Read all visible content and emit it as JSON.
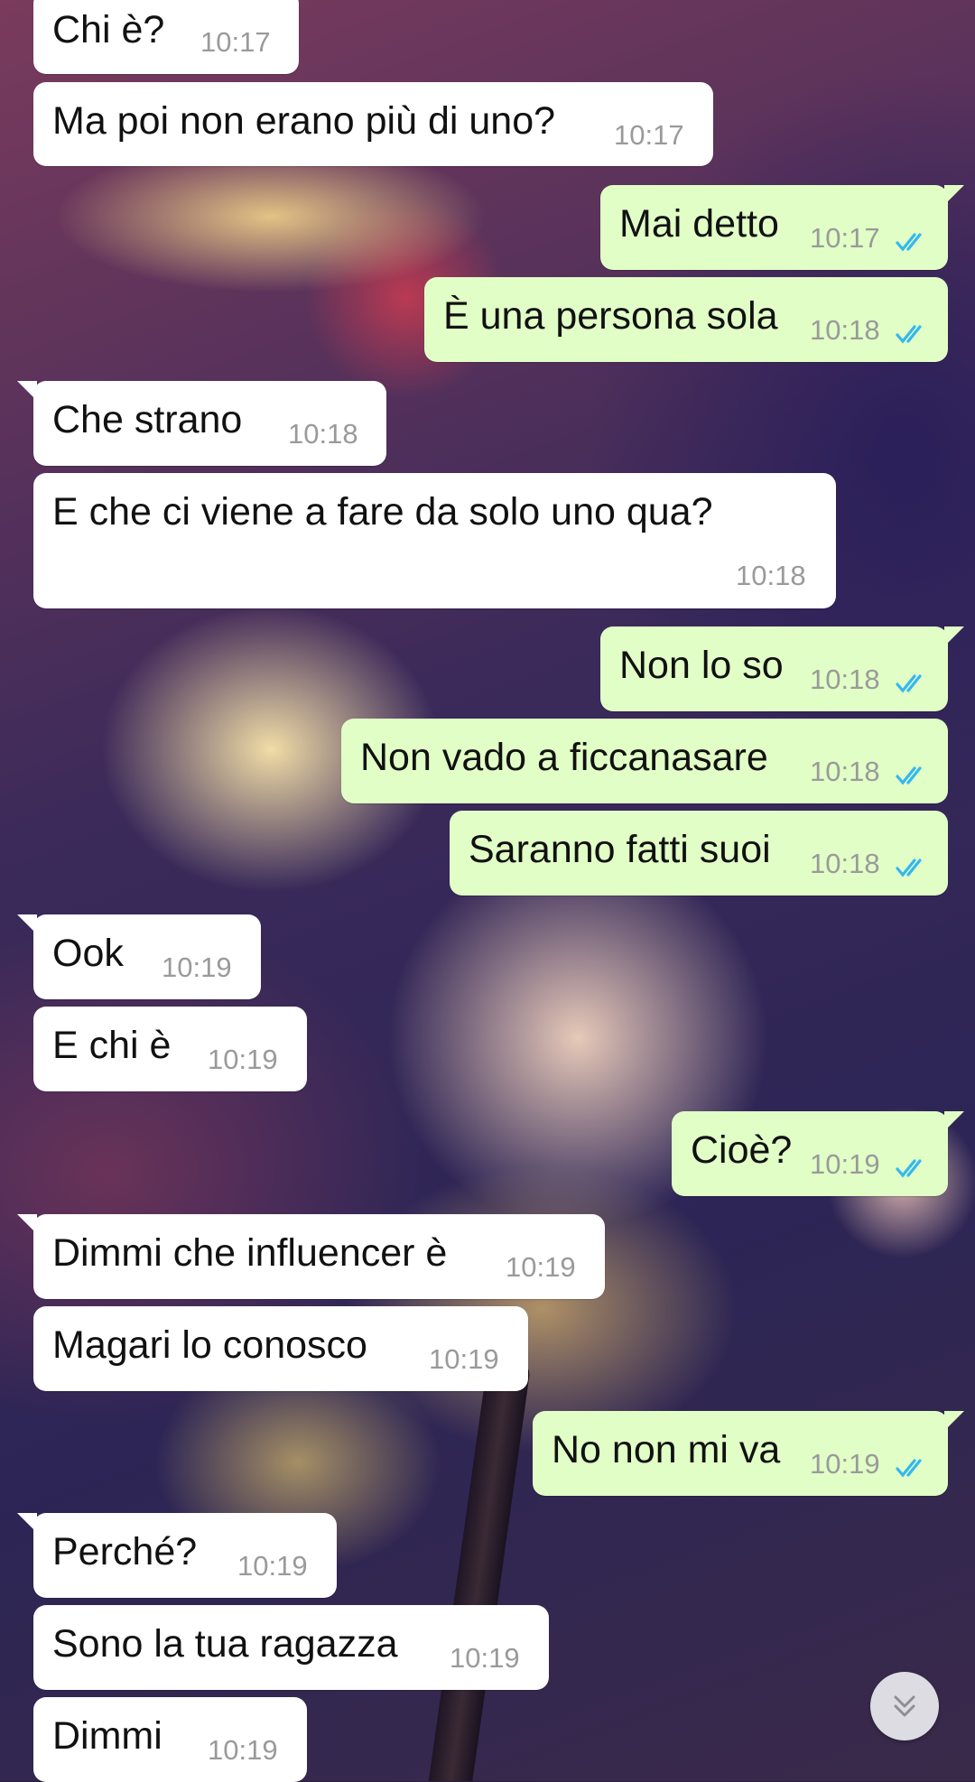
{
  "colors": {
    "incoming": "#ffffff",
    "outgoing": "#e1fec6",
    "time": "#9a9a9a",
    "read_ticks": "#34b7f1"
  },
  "messages": [
    {
      "dir": "in",
      "text": "Chi è?",
      "time": "10:17"
    },
    {
      "dir": "in",
      "text": "Ma poi non erano più di uno?",
      "time": "10:17"
    },
    {
      "dir": "out",
      "text": "Mai detto",
      "time": "10:17",
      "status": "read"
    },
    {
      "dir": "out",
      "text": "È una persona sola",
      "time": "10:18",
      "status": "read"
    },
    {
      "dir": "in",
      "text": "Che strano",
      "time": "10:18"
    },
    {
      "dir": "in",
      "text": "E che ci viene a fare da solo uno qua?",
      "time": "10:18"
    },
    {
      "dir": "out",
      "text": "Non lo so",
      "time": "10:18",
      "status": "read"
    },
    {
      "dir": "out",
      "text": "Non vado a ficcanasare",
      "time": "10:18",
      "status": "read"
    },
    {
      "dir": "out",
      "text": "Saranno fatti suoi",
      "time": "10:18",
      "status": "read"
    },
    {
      "dir": "in",
      "text": "Ook",
      "time": "10:19"
    },
    {
      "dir": "in",
      "text": "E chi è",
      "time": "10:19"
    },
    {
      "dir": "out",
      "text": "Cioè?",
      "time": "10:19",
      "status": "read"
    },
    {
      "dir": "in",
      "text": "Dimmi che influencer è",
      "time": "10:19"
    },
    {
      "dir": "in",
      "text": "Magari lo conosco",
      "time": "10:19"
    },
    {
      "dir": "out",
      "text": "No non mi va",
      "time": "10:19",
      "status": "read"
    },
    {
      "dir": "in",
      "text": "Perché?",
      "time": "10:19"
    },
    {
      "dir": "in",
      "text": "Sono la tua ragazza",
      "time": "10:19"
    },
    {
      "dir": "in",
      "text": "Dimmi",
      "time": "10:19"
    }
  ],
  "scroll_button": {
    "icon": "double-chevron-down-icon"
  }
}
